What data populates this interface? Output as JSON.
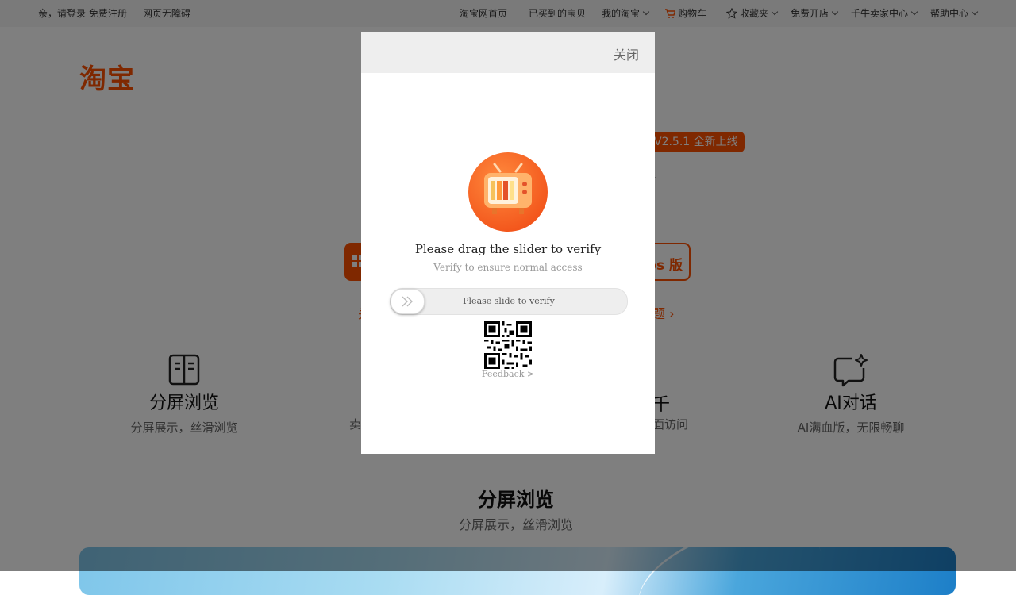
{
  "topbar": {
    "login": "亲，请登录",
    "register": "免费注册",
    "accessibility": "网页无障碍",
    "home": "淘宝网首页",
    "bought": "已买到的宝贝",
    "my_taobao": "我的淘宝",
    "cart": "购物车",
    "favorites": "收藏夹",
    "open_shop": "免费开店",
    "seller_center": "千牛卖家中心",
    "help": "帮助中心"
  },
  "page": {
    "logo": "淘宝",
    "version_badge": "V2.5.1 全新上线",
    "dot": ".",
    "mac_label": "os 版",
    "left_glyph": "关",
    "faq_link": "题 ›",
    "features": [
      {
        "title": "分屏浏览",
        "desc": "分屏展示，丝滑浏览",
        "icon": "split-screen-icon"
      },
      {
        "title": "AI对话",
        "desc": "AI满血版，无限畅聊",
        "icon": "ai-chat-icon"
      }
    ],
    "partial_title": "千",
    "partial_desc": "面访问",
    "partial_left": "卖",
    "section_title": "分屏浏览",
    "section_sub": "分屏展示，丝滑浏览"
  },
  "modal": {
    "close": "关闭",
    "title": "Please drag the slider to verify",
    "subtitle": "Verify to ensure normal access",
    "slider_text": "Please slide to verify",
    "feedback": "Feedback >"
  },
  "colors": {
    "brand": "#ff5000",
    "overlay": "rgba(0,0,0,0.5)"
  }
}
